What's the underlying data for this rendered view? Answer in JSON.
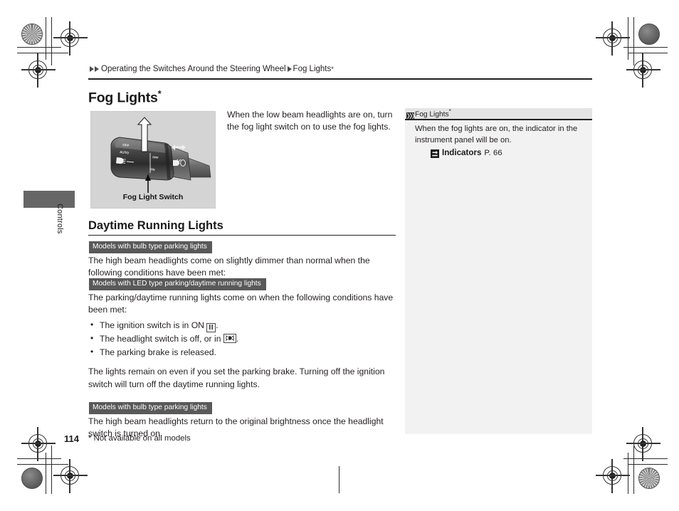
{
  "document": {
    "page_number": "114",
    "footnote": "* Not available on all models",
    "side_tab_label": "Controls"
  },
  "breadcrumb": {
    "item1": "Operating the Switches Around the Steering Wheel",
    "item2": "Fog Lights",
    "item2_sup": "*"
  },
  "heading": {
    "title": "Fog Lights",
    "sup": "*"
  },
  "illustration": {
    "caption": "Fog Light Switch",
    "stalk_labels": {
      "top": "OFF",
      "auto": "AUTO",
      "beam": "beam-symbol",
      "fog_off": "OFF",
      "fog_on": "ON",
      "fog_symbol": "fog-light-symbol",
      "turn_symbol": "turn-signal-symbol"
    }
  },
  "intro": {
    "text": "When the low beam headlights are on, turn the fog light switch on to use the fog lights."
  },
  "section": {
    "title": "Daytime Running Lights",
    "blocks": [
      {
        "badge": "Models with bulb type parking lights",
        "text": "The high beam headlights come on slightly dimmer than normal when the following conditions have been met:"
      },
      {
        "badge": "Models with LED type parking/daytime running lights",
        "text": "The parking/daytime running lights come on when the following conditions have been met:"
      }
    ],
    "bullets": [
      {
        "before": "The ignition switch is in ON ",
        "glyph": "ignition-on-II",
        "after": "."
      },
      {
        "before": "The headlight switch is off, or in ",
        "glyph": "parking-light-symbol",
        "after": "."
      },
      {
        "before": "The parking brake is released.",
        "glyph": "",
        "after": ""
      }
    ],
    "closing_paragraph": "The lights remain on even if you set the parking brake. Turning off the ignition switch will turn off the daytime running lights.",
    "final_block": {
      "badge": "Models with bulb type parking lights",
      "text": "The high beam headlights return to the original brightness once the headlight switch is turned on."
    }
  },
  "sidebar": {
    "header_icon": "hatched-square-icon",
    "header_title": "Fog Lights",
    "header_sup": "*",
    "body_text": "When the fog lights are on, the indicator in the instrument panel will be on.",
    "reference": {
      "icon": "goto-page-arrow-icon",
      "name": "Indicators",
      "page": "P. 66"
    }
  },
  "colors": {
    "badge_bg": "#595959",
    "sidebar_bg": "#f2f2f2",
    "sidebar_header_bg": "#e4e4e4",
    "illustration_bg": "#d4d4d4",
    "rule": "#231f20",
    "tab_bg": "#666666"
  }
}
